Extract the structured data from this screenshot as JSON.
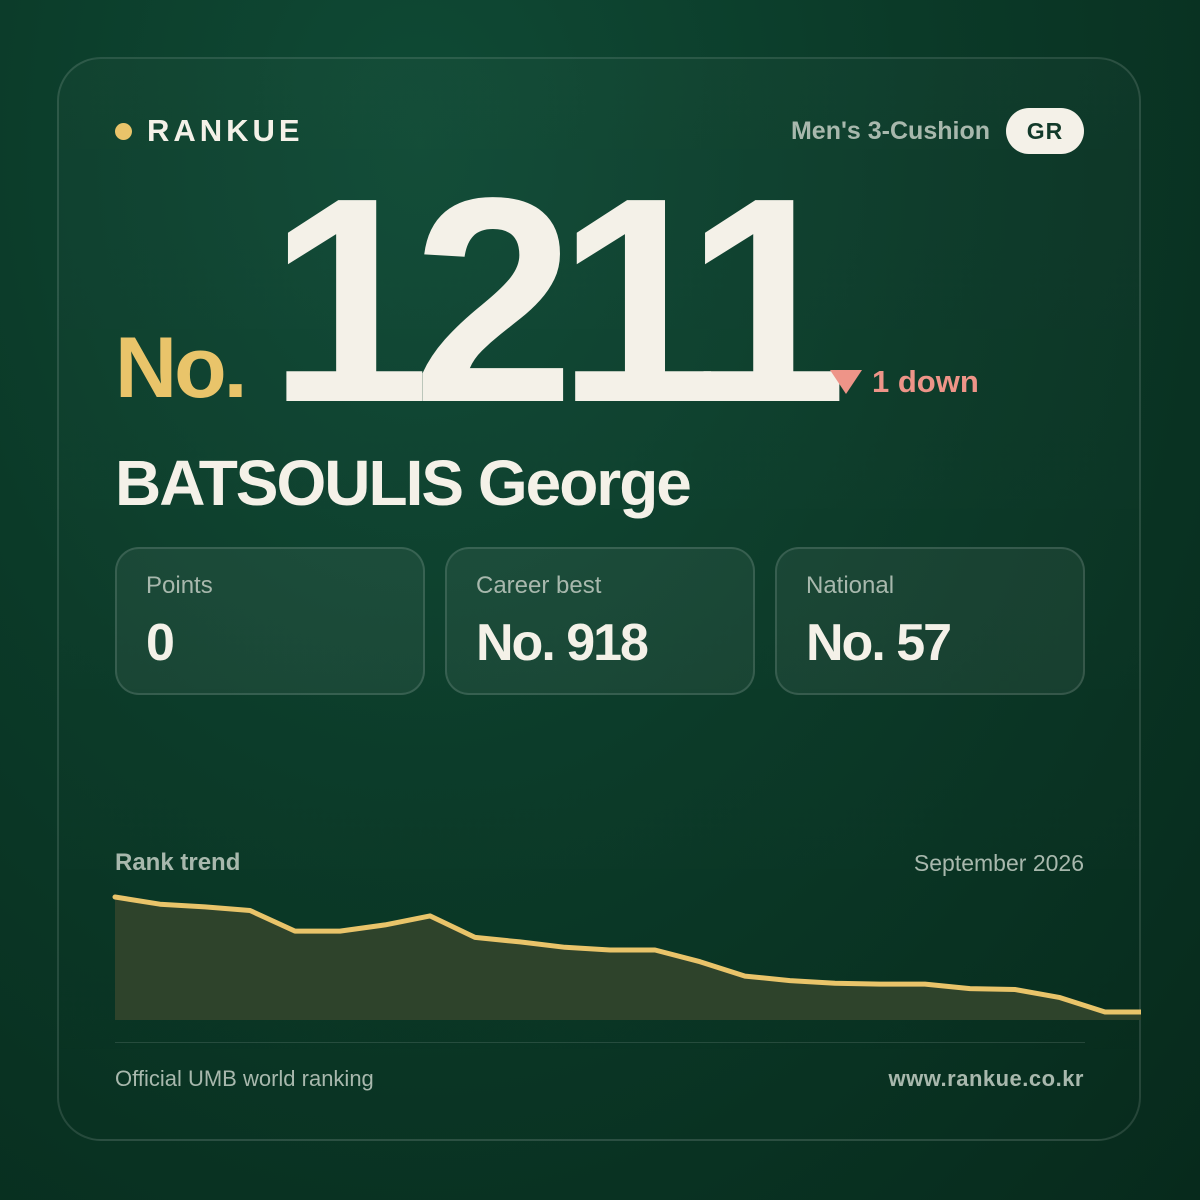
{
  "brand": {
    "name": "RANKUE",
    "accent_color": "#e9c46a"
  },
  "header": {
    "category": "Men's 3-Cushion",
    "country": "GR"
  },
  "rank": {
    "prefix": "No.",
    "number": "1211",
    "change_label": "1 down",
    "change_icon": "triangle-down-icon",
    "change_color": "#ee9488"
  },
  "player": {
    "name": "BATSOULIS George"
  },
  "stats": [
    {
      "label": "Points",
      "value": "0"
    },
    {
      "label": "Career best",
      "value": "No. 918"
    },
    {
      "label": "National",
      "value": "No. 57"
    }
  ],
  "trend": {
    "title": "Rank trend",
    "date": "September 2026"
  },
  "chart_data": {
    "type": "area",
    "title": "Rank trend",
    "y_inverted": true,
    "ylim": [
      1211,
      918
    ],
    "x": [
      1,
      2,
      3,
      4,
      5,
      6,
      7,
      8,
      9,
      10,
      11,
      12,
      13,
      14,
      15,
      16,
      17,
      18,
      19,
      20,
      21,
      22,
      23,
      24
    ],
    "series": [
      {
        "values": [
          1010,
          1018,
          1021,
          1025,
          1048,
          1048,
          1041,
          1031,
          1055,
          1060,
          1066,
          1069,
          1069,
          1082,
          1098,
          1103,
          1106,
          1107,
          1107,
          1112,
          1113,
          1122,
          1138,
          1138
        ],
        "color": "#e9c46a"
      }
    ],
    "grid": false,
    "legend": "none"
  },
  "footer": {
    "left": "Official UMB world ranking",
    "right": "www.rankue.co.kr"
  }
}
